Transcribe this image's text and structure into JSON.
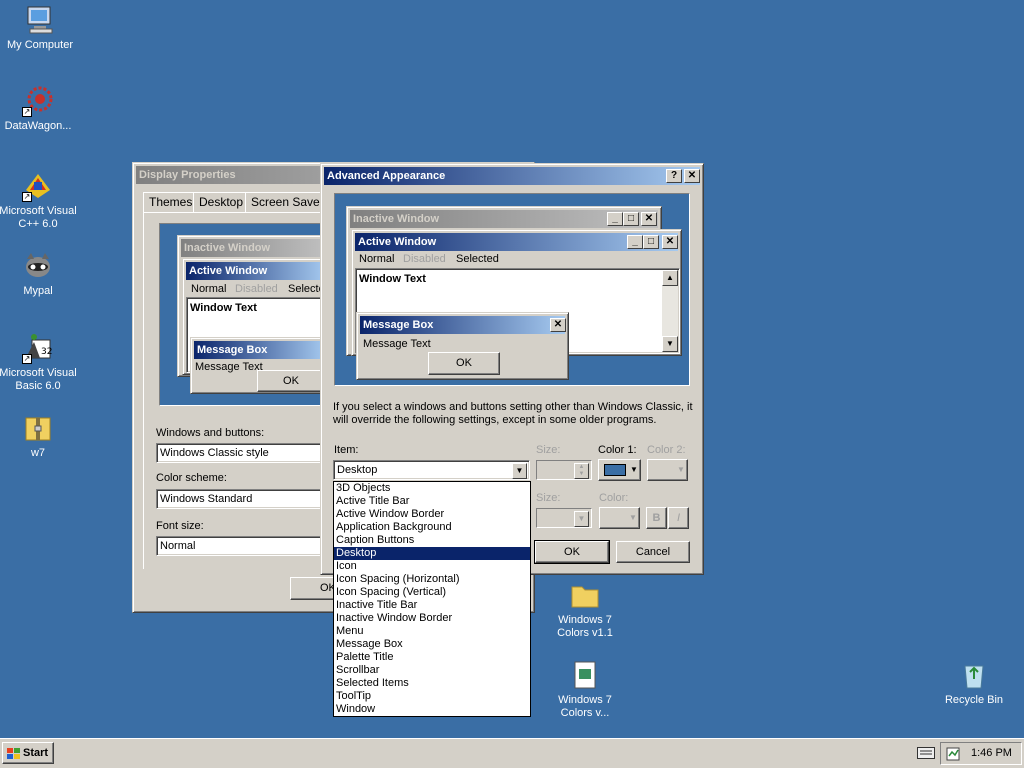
{
  "desktop": {
    "icons": [
      {
        "label": "My Computer"
      },
      {
        "label": "DataWagon..."
      },
      {
        "label": "Microsoft Visual C++ 6.0"
      },
      {
        "label": "Mypal"
      },
      {
        "label": "Microsoft Visual Basic 6.0"
      },
      {
        "label": "w7"
      },
      {
        "label": "Windows 7 Colors v1.1"
      },
      {
        "label": "Windows 7 Colors v..."
      },
      {
        "label": "Recycle Bin"
      }
    ]
  },
  "display_properties": {
    "title": "Display Properties",
    "tabs": [
      "Themes",
      "Desktop",
      "Screen Saver"
    ],
    "preview": {
      "inactive_title": "Inactive Window",
      "active_title": "Active Window",
      "menu": [
        "Normal",
        "Disabled",
        "Selected"
      ],
      "window_text": "Window Text",
      "msgbox_title": "Message Box",
      "msgbox_text": "Message Text",
      "ok": "OK"
    },
    "windows_buttons_label": "Windows and buttons:",
    "windows_buttons_value": "Windows Classic style",
    "color_scheme_label": "Color scheme:",
    "color_scheme_value": "Windows Standard",
    "font_size_label": "Font size:",
    "font_size_value": "Normal",
    "ok": "OK"
  },
  "advanced_appearance": {
    "title": "Advanced Appearance",
    "help_glyph": "?",
    "close_glyph": "✕",
    "preview": {
      "inactive_title": "Inactive Window",
      "active_title": "Active Window",
      "menu": [
        "Normal",
        "Disabled",
        "Selected"
      ],
      "window_text": "Window Text",
      "msgbox_title": "Message Box",
      "msgbox_text": "Message Text",
      "ok": "OK"
    },
    "info_text": "If you select a windows and buttons setting other than Windows Classic, it will override the following settings, except in some older programs.",
    "item_label": "Item:",
    "item_value": "Desktop",
    "size_label": "Size:",
    "color1_label": "Color 1:",
    "color2_label": "Color 2:",
    "font_size_label": "Size:",
    "font_color_label": "Color:",
    "bold": "B",
    "italic": "I",
    "ok": "OK",
    "cancel": "Cancel",
    "color1_swatch": "#3a6ea5",
    "item_options": [
      "3D Objects",
      "Active Title Bar",
      "Active Window Border",
      "Application Background",
      "Caption Buttons",
      "Desktop",
      "Icon",
      "Icon Spacing (Horizontal)",
      "Icon Spacing (Vertical)",
      "Inactive Title Bar",
      "Inactive Window Border",
      "Menu",
      "Message Box",
      "Palette Title",
      "Scrollbar",
      "Selected Items",
      "ToolTip",
      "Window"
    ],
    "selected_option": "Desktop"
  },
  "taskbar": {
    "start": "Start",
    "clock": "1:46 PM"
  },
  "colors": {
    "desktop": "#3a6ea5",
    "title_active": "#0a246a",
    "face": "#d4d0c8"
  }
}
